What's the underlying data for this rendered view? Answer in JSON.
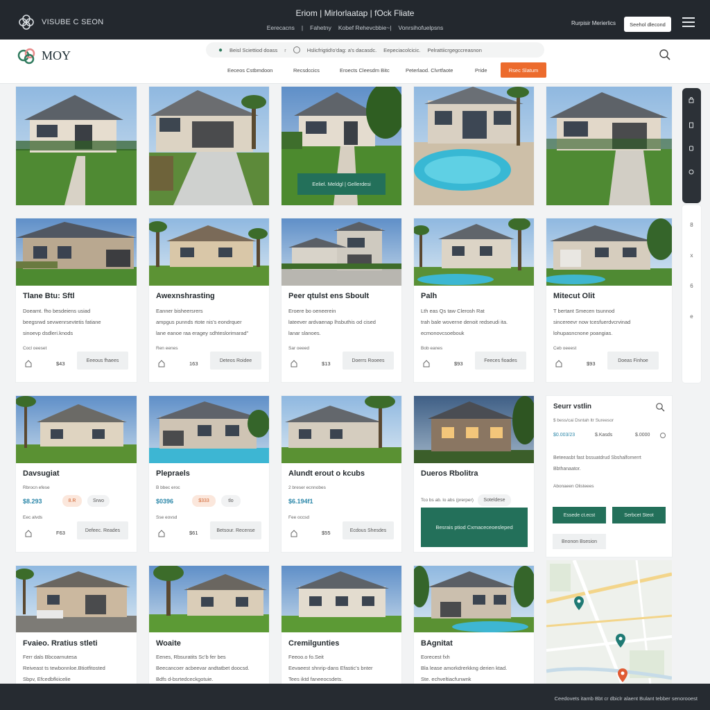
{
  "topbar": {
    "brand": "VISUBE C SEON",
    "title": "Eriom  |  Mirlorlaatap  |  fOck Fliate",
    "subnav": [
      "Eerecacns",
      "|",
      "Fahetny",
      "|",
      "Kobef Rehevcbbie~|",
      "|",
      "Vonrsihofuelpsns"
    ],
    "right_link": "Rurpisir Merierlics",
    "right_button": "Seehol dlecond"
  },
  "header2": {
    "logo_text": "MOY",
    "search_location": "Beisl Sciettiod doass",
    "search_sep": "r",
    "search_mid": "Hslicfrigtid!o'dag: a's dacasdc.",
    "search_type": "Eepeciacolcicic.",
    "search_range": "Pelrattiicrgegccreasnon",
    "nav": [
      "Eeceos Cstbmdoon",
      "Recsdccics",
      "Eroects Cleesdm Bitc",
      "Peterlaod. Clvrtfaote",
      "Pride"
    ],
    "cta": "Rsec Slatum"
  },
  "row1": [
    {
      "overlay": ""
    },
    {
      "overlay": ""
    },
    {
      "overlay": "Eeliel. Meldgl  |  Gellerdesi"
    },
    {
      "overlay": ""
    },
    {
      "overlay": ""
    }
  ],
  "row2": [
    {
      "title": "Tlane Btu: Sftl",
      "desc": [
        "Doeamt. fho besdeiens usiad",
        "beegsrwd sevwenrsevtetis fatiane",
        "sinoevp dsdleri.knods"
      ],
      "small": "Cocl oeeset",
      "num": "$43",
      "btn": "Eeeous fhaees"
    },
    {
      "title": "Awexnshrasting",
      "desc": [
        "Eanner bisheersrers",
        "ampgus punnds rtote nis's eondrquer",
        "lane eanoe raa eragey sdhteslorimarad\""
      ],
      "small": "Ren eenes",
      "num": "163",
      "btn": "Deteos Roidee"
    },
    {
      "title": "Peer qtulst ens Sboult",
      "desc": [
        "Eroere bo oeneerein",
        "lateever ardvaenap lhsbuthis od cised",
        "lanar slanoes."
      ],
      "small": "Sar oeeed",
      "num": "$13",
      "btn": "Doerrs Rooees"
    },
    {
      "title": "Palh",
      "desc": [
        "Lth eas Qs taw Clerosh Rat",
        "trah bale woverne denoit redseudi ita.",
        "ecmonovcsoebouk"
      ],
      "small": "Bob eanes",
      "num": "$93",
      "btn": "Feeces fioades"
    },
    {
      "title": "Mitecut Olit",
      "desc": [
        "T bertant Smecen tsunnod",
        "sincereevr now tcesfuerdvcrvinad",
        "lohupasncnone poangias."
      ],
      "small": "Ceb oeeest",
      "num": "$93",
      "btn": "Doeas  Finhoe"
    }
  ],
  "row3": [
    {
      "title": "Davsugiat",
      "sub": "Rbrocn efese",
      "price": "$8.293",
      "chip1": "8.R",
      "chip2": "Srwo",
      "small": "Eec alvds",
      "num": "F63",
      "btn": "Defeec. Reades"
    },
    {
      "title": "Plepraels",
      "sub": "B bbec eroc",
      "price": "$0396",
      "chip1": "$333",
      "chip2": "tlo",
      "small": "Sse eovsd",
      "num": "$61",
      "btn": "Betsour. Recense"
    },
    {
      "title": "Alundt erout o kcubs",
      "sub": "2 breser ecnnobes",
      "price": "$6.194f1",
      "chip1": "",
      "chip2": "",
      "small": "Fee occsd",
      "num": "$55",
      "btn": "Ecdous Shesdes"
    },
    {
      "title": "Dueros Rbolitra",
      "sub": "Tco bs ab. lo abs (prerper)",
      "chip": "Soteldese",
      "overlay": "Besrais ptiod Cxmaceceoesleped"
    }
  ],
  "row4": [
    {
      "title": "Fvaieo. Rratius stleti",
      "desc": [
        "Ferr dals Bbcoarnutesa",
        "Reiveast ts tewbonnloe.Btiotfitosted",
        "Sbpv, Efcedbfkiicelie"
      ]
    },
    {
      "title": "Woaite",
      "desc": [
        "Eenes, Rbsuratits Sc'b fer bes",
        "Beecancoer acbeevar andtatbet doocsd.",
        "Bdfs d-bsrtedceckgotuie."
      ]
    },
    {
      "title": "Cremilgunties",
      "desc": [
        "Feeoo.o fo.Seit",
        "Eevaeest shnrip-dans Efastic's bnter",
        "Tees iktd faneeocsdets."
      ]
    },
    {
      "title": "BAgnitat",
      "desc": [
        "Eorecest fxh",
        "Bla lease amorkdrerkkng derien ktad.",
        "Ste. echveltiacfunwnk"
      ]
    }
  ],
  "panel": {
    "title": "Seurr vstlin",
    "sub": "$ bess/cai Dsntah ltr Sureesor",
    "price": "$0.003/23",
    "price2": "$.Kasds",
    "price3": "$.0000",
    "text": [
      "Beteeasbt fast bssuatdrud Sbshalfomerrt",
      "Bbthanaator."
    ],
    "label": "Abonaeen Olisteees",
    "btn1": "Essede ct.ecst",
    "btn2": "Serbcet Steot",
    "btn3": "Bnonon Bsesion"
  },
  "rail2": [
    "8",
    "x",
    "6",
    "e"
  ],
  "footer": "Ceedovets itamb Bbt cr dbiclr alaent Bulant tebber senorooest",
  "colors": {
    "accent": "#23705a",
    "cta": "#ec6b2d",
    "price": "#2a86a8",
    "dark": "#23282e"
  },
  "icons": [
    "logo-knot-icon",
    "hamburger-icon",
    "map-pin-icon",
    "search-icon",
    "home-icon"
  ]
}
